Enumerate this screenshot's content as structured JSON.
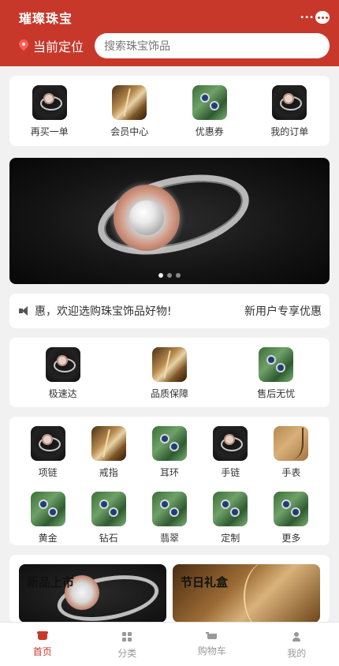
{
  "header": {
    "brand": "璀璨珠宝",
    "location_label": "当前定位",
    "search_placeholder": "搜索珠宝饰品",
    "background": "#c8382a"
  },
  "quick_actions": [
    {
      "label": "再买一单",
      "image": "ring-thumb"
    },
    {
      "label": "会员中心",
      "image": "gold-chain-thumb"
    },
    {
      "label": "优惠券",
      "image": "sapphire-earrings-thumb"
    },
    {
      "label": "我的订单",
      "image": "ring-thumb"
    }
  ],
  "banner": {
    "image": "diamond-ring-photo",
    "slides": 3,
    "active_slide": 1
  },
  "notice": {
    "text": "享优惠，欢迎选购珠宝饰品好物!",
    "right_label": "新用户专享优惠"
  },
  "services": [
    {
      "label": "极速达",
      "image": "ring-thumb"
    },
    {
      "label": "品质保障",
      "image": "gold-chain-thumb"
    },
    {
      "label": "售后无忧",
      "image": "sapphire-earrings-thumb"
    }
  ],
  "categories": [
    {
      "label": "项链",
      "image": "ring-thumb"
    },
    {
      "label": "戒指",
      "image": "gold-chain-thumb"
    },
    {
      "label": "耳环",
      "image": "sapphire-earrings-thumb"
    },
    {
      "label": "手链",
      "image": "ring-thumb"
    },
    {
      "label": "手表",
      "image": "gold-pendant-thumb"
    },
    {
      "label": "黄金",
      "image": "sapphire-earrings-thumb"
    },
    {
      "label": "钻石",
      "image": "sapphire-earrings-thumb"
    },
    {
      "label": "翡翠",
      "image": "sapphire-earrings-thumb"
    },
    {
      "label": "定制",
      "image": "sapphire-earrings-thumb"
    },
    {
      "label": "更多",
      "image": "sapphire-earrings-thumb"
    }
  ],
  "promos": [
    {
      "title": "新品上市",
      "image": "diamond-ring-photo"
    },
    {
      "title": "节日礼盒",
      "image": "gold-chain-photo"
    }
  ],
  "tabbar": [
    {
      "label": "首页",
      "icon": "home-icon",
      "active": true
    },
    {
      "label": "分类",
      "icon": "category-icon",
      "active": false
    },
    {
      "label": "购物车",
      "icon": "cart-icon",
      "active": false
    },
    {
      "label": "我的",
      "icon": "user-icon",
      "active": false
    }
  ],
  "colors": {
    "accent": "#c8382a",
    "inactive_tab": "#999999"
  }
}
